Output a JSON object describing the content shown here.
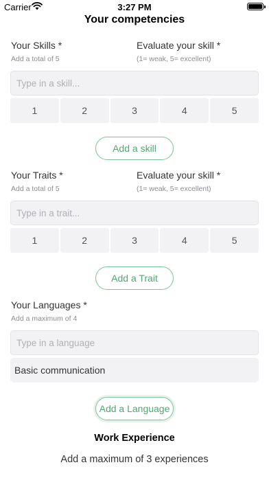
{
  "status_bar": {
    "carrier": "Carrier",
    "time": "3:27 PM"
  },
  "page_title": "Your competencies",
  "skills": {
    "label": "Your Skills *",
    "hint": "Add a total of 5",
    "evaluate_label": "Evaluate your skill *",
    "evaluate_hint": "(1= weak, 5= excellent)",
    "input_placeholder": "Type in a skill...",
    "ratings": [
      "1",
      "2",
      "3",
      "4",
      "5"
    ],
    "add_button": "Add a skill"
  },
  "traits": {
    "label": "Your Traits *",
    "hint": "Add a total of 5",
    "evaluate_label": "Evaluate your skill *",
    "evaluate_hint": "(1= weak, 5= excellent)",
    "input_placeholder": "Type in a trait...",
    "ratings": [
      "1",
      "2",
      "3",
      "4",
      "5"
    ],
    "add_button": "Add a Trait"
  },
  "languages": {
    "label": "Your Languages *",
    "hint": "Add a maximum of 4",
    "input_placeholder": "Type in a language",
    "level_value": "Basic communication",
    "add_button": "Add a Language"
  },
  "work_experience": {
    "title": "Work Experience",
    "subtitle": "Add a maximum of 3 experiences"
  }
}
